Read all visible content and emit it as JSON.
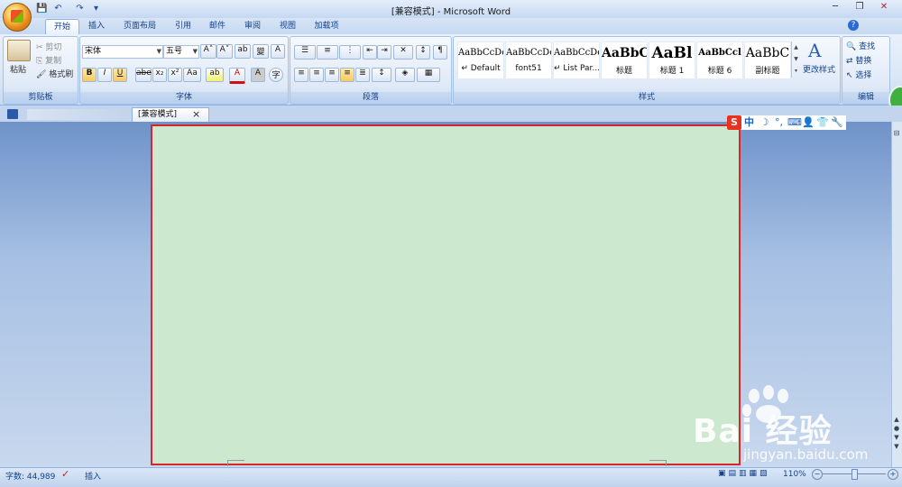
{
  "window": {
    "title": "[兼容模式] - Microsoft Word"
  },
  "quick_access": {
    "save": "💾",
    "undo": "↶",
    "redo": "↷",
    "customize": "▾"
  },
  "tabs": [
    "开始",
    "插入",
    "页面布局",
    "引用",
    "邮件",
    "审阅",
    "视图",
    "加载项"
  ],
  "clipboard": {
    "paste": "粘贴",
    "cut": "剪切",
    "copy": "复制",
    "format_painter": "格式刷",
    "label": "剪贴板"
  },
  "font": {
    "name": "宋体",
    "size": "五号",
    "label": "字体",
    "bold": "B",
    "italic": "I",
    "underline": "U",
    "strike": "abe",
    "sub": "x₂",
    "sup": "x²",
    "case": "Aa",
    "grow": "A˄",
    "shrink": "A˅",
    "clear": "ab",
    "phonetic": "變",
    "border_char": "A",
    "highlight": "ab",
    "color": "A",
    "shade": "A",
    "circle": "字"
  },
  "paragraph": {
    "label": "段落"
  },
  "styles": {
    "label": "样式",
    "items": [
      {
        "preview": "AaBbCcDc",
        "name": "↵ Default"
      },
      {
        "preview": "AaBbCcDc",
        "name": "font51"
      },
      {
        "preview": "AaBbCcDd",
        "name": "↵ List Par..."
      },
      {
        "preview": "AaBbC",
        "name": "标题"
      },
      {
        "preview": "AaBl",
        "name": "标题 1"
      },
      {
        "preview": "AaBbCcl",
        "name": "标题 6"
      },
      {
        "preview": "AaBbC",
        "name": "副标题"
      }
    ],
    "change_styles": "更改样式"
  },
  "editing": {
    "label": "编辑",
    "find": "查找",
    "replace": "替换",
    "select": "选择"
  },
  "document_tab": {
    "title": "[兼容模式]",
    "close": "×"
  },
  "ime_bar": {
    "logo": "S",
    "mode": "中",
    "moon": "☽",
    "punct": "°,",
    "keyboard": "⌨",
    "user": "👤",
    "skin": "👕",
    "tools": "🔧"
  },
  "status": {
    "word_count": "字数: 44,989",
    "insert_mode": "插入",
    "zoom": "110%"
  },
  "watermark": {
    "brand": "Bai  经验",
    "url": "jingyan.baidu.com"
  },
  "colors": {
    "page": "#cce8cf",
    "highlight_border": "#d8262e",
    "ribbon": "#dbe7f6"
  }
}
